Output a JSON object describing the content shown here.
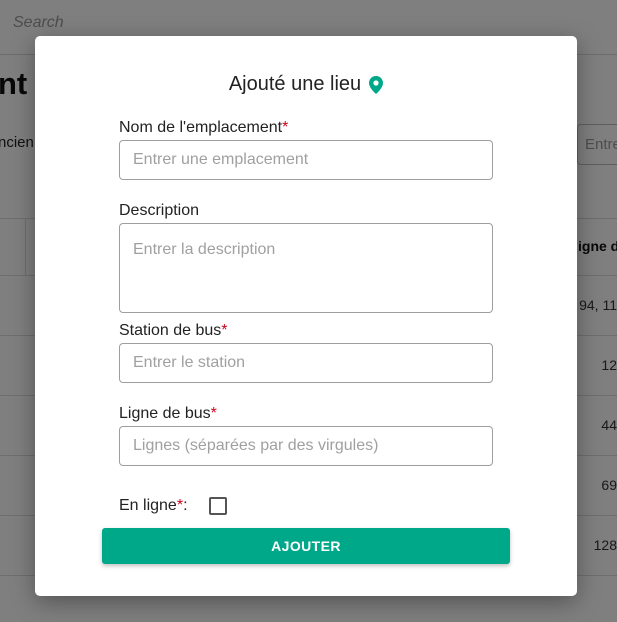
{
  "background": {
    "search_placeholder": "Search",
    "heading_fragment": "nt",
    "left_label_fragment": "ncien",
    "right_input_fragment": "Entre",
    "column_header_fragment": "igne d",
    "row_values": [
      "94, 11",
      "12",
      "44",
      "69",
      "128"
    ]
  },
  "modal": {
    "title": "Ajouté une lieu",
    "title_icon": "map-pin-icon",
    "accent_color": "#00a88a",
    "required_marker_color": "#d0021b",
    "fields": {
      "location_name": {
        "label": "Nom de l'emplacement",
        "required_mark": "*",
        "value": "",
        "placeholder": "Entrer une emplacement"
      },
      "description": {
        "label": "Description",
        "value": "",
        "placeholder": "Entrer la description"
      },
      "bus_station": {
        "label": "Station de bus",
        "required_mark": "*",
        "value": "",
        "placeholder": "Entrer le station"
      },
      "bus_line": {
        "label": "Ligne de bus",
        "required_mark": "*",
        "value": "",
        "placeholder": "Lignes (séparées par des virgules)"
      },
      "online": {
        "label": "En ligne",
        "required_mark": "*",
        "suffix": ":",
        "checked": false
      }
    },
    "submit_label": "AJOUTER"
  }
}
